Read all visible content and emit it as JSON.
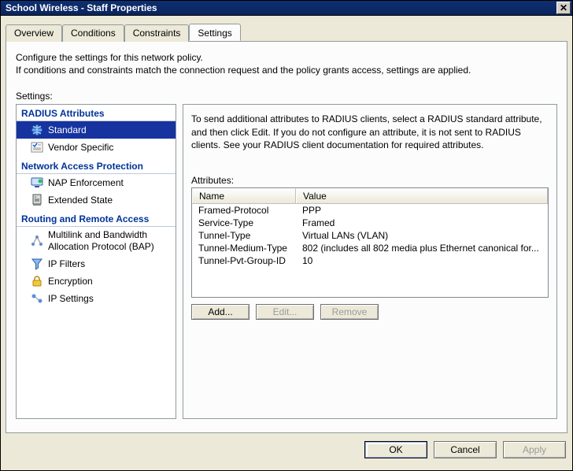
{
  "title": "School Wireless - Staff Properties",
  "tabs": {
    "overview": "Overview",
    "conditions": "Conditions",
    "constraints": "Constraints",
    "settings": "Settings"
  },
  "intro": {
    "line1": "Configure the settings for this network policy.",
    "line2": "If conditions and constraints match the connection request and the policy grants access, settings are applied."
  },
  "settings_label": "Settings:",
  "tree": {
    "radius_header": "RADIUS Attributes",
    "standard": "Standard",
    "vendor": "Vendor Specific",
    "nap_header": "Network Access Protection",
    "nap_enforcement": "NAP Enforcement",
    "extended_state": "Extended State",
    "rra_header": "Routing and Remote Access",
    "bap": "Multilink and Bandwidth Allocation Protocol (BAP)",
    "ip_filters": "IP Filters",
    "encryption": "Encryption",
    "ip_settings": "IP Settings"
  },
  "right": {
    "intro": "To send additional attributes to RADIUS clients, select a RADIUS standard attribute, and then click Edit. If you do not configure an attribute, it is not sent to RADIUS clients. See your RADIUS client documentation for required attributes.",
    "attributes_label": "Attributes:",
    "col_name": "Name",
    "col_value": "Value",
    "rows": [
      {
        "name": "Framed-Protocol",
        "value": "PPP"
      },
      {
        "name": "Service-Type",
        "value": "Framed"
      },
      {
        "name": "Tunnel-Type",
        "value": "Virtual LANs (VLAN)"
      },
      {
        "name": "Tunnel-Medium-Type",
        "value": "802 (includes all 802 media plus Ethernet canonical for..."
      },
      {
        "name": "Tunnel-Pvt-Group-ID",
        "value": "10"
      }
    ],
    "add": "Add...",
    "edit": "Edit...",
    "remove": "Remove"
  },
  "dlg": {
    "ok": "OK",
    "cancel": "Cancel",
    "apply": "Apply"
  }
}
